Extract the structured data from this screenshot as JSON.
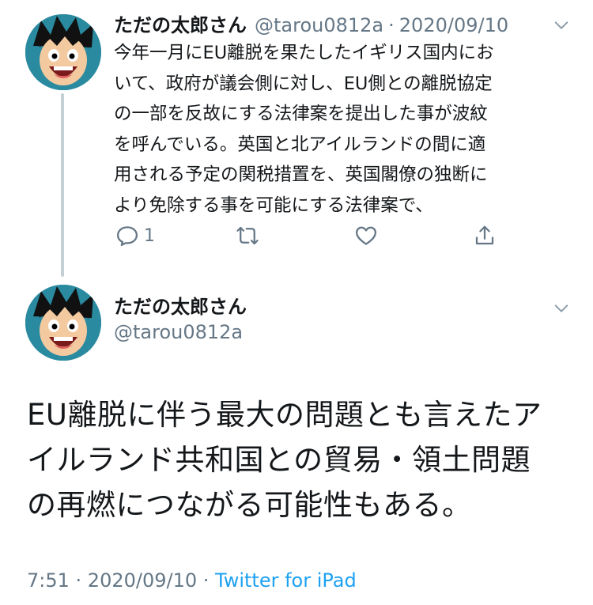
{
  "tweet1": {
    "author_name": "ただの太郎さん",
    "handle": "@tarou0812a",
    "separator": "·",
    "date": "2020/09/10",
    "text_lines": [
      "今年一月にEU離脱を果たしたイギリス国内にお",
      "いて、政府が議会側に対し、EU側との離脱協定",
      "の一部を反故にする法律案を提出した事が波紋",
      "を呼んでいる。英国と北アイルランドの間に適",
      "用される予定の関税措置を、英国閣僚の独断に",
      "より免除する事を可能にする法律案で、"
    ],
    "reply_count": "1",
    "icons": [
      "reply-icon",
      "retweet-icon",
      "like-icon",
      "share-icon",
      "chevron-down-icon"
    ]
  },
  "tweet2": {
    "author_name": "ただの太郎さん",
    "handle": "@tarou0812a",
    "text_lines": [
      "EU離脱に伴う最大の問題とも言えたア",
      "イルランド共和国との貿易・領土問題",
      "の再燃につながる可能性もある。"
    ],
    "time": "7:51",
    "separator1": " · ",
    "date": "2020/09/10",
    "separator2": " · ",
    "source": "Twitter for iPad"
  },
  "colors": {
    "text": "#14171a",
    "muted": "#657786",
    "link": "#1da1f2",
    "thread_line": "#c4cfd6"
  }
}
